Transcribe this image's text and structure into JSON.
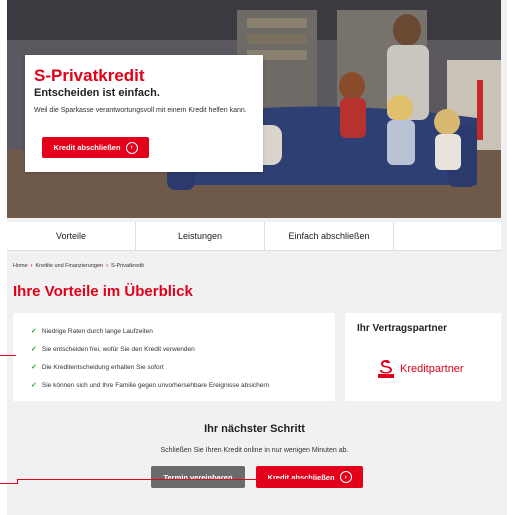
{
  "hero": {
    "title": "S-Privatkredit",
    "subtitle": "Entscheiden ist einfach.",
    "text": "Weil die Sparkasse verantwortungsvoll mit einem Kredit helfen kann.",
    "button_label": "Kredit abschließen",
    "button_icon": "arrow-right-icon"
  },
  "nav": {
    "tabs": [
      "Vorteile",
      "Leistungen",
      "Einfach abschließen"
    ]
  },
  "breadcrumb": [
    "Home",
    "Kredite und Finanzierungen",
    "S-Privatkredit"
  ],
  "benefits": {
    "title": "Ihre Vorteile im Überblick",
    "items": [
      "Niedrige Raten durch lange Laufzeiten",
      "Sie entscheiden frei, wofür Sie den Kredit verwenden",
      "Die Kreditentscheidung erhalten Sie sofort",
      "Sie können sich und Ihre Familie gegen unvorhersehbare Ereignisse absichern"
    ]
  },
  "partner": {
    "title": "Ihr Vertragspartner",
    "logo_text": "Kreditpartner"
  },
  "next_step": {
    "title": "Ihr nächster Schritt",
    "text": "Schließen Sie Ihren Kredit online in nur wenigen Minuten ab.",
    "appointment_label": "Termin vereinbaren",
    "credit_label": "Kredit abschließen"
  },
  "colors": {
    "accent": "#e2001a",
    "check": "#2e9e2e",
    "grey_button": "#6b6b6b"
  }
}
